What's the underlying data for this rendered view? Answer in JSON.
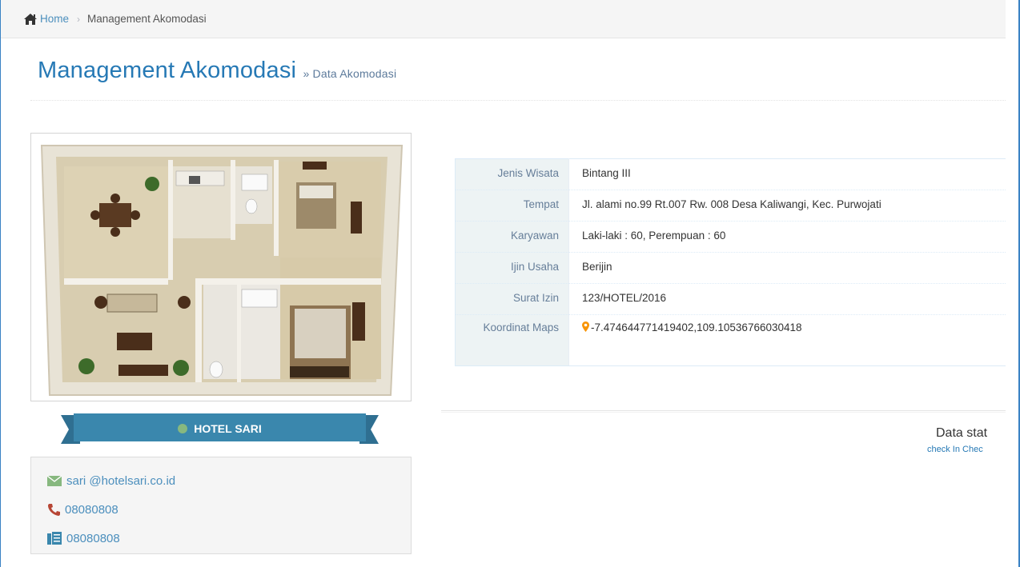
{
  "breadcrumb": {
    "home_label": "Home",
    "current": "Management Akomodasi"
  },
  "header": {
    "title": "Management Akomodasi",
    "subtitle": "» Data Akomodasi"
  },
  "hotel": {
    "name": "HOTEL SARI",
    "email": "sari @hotelsari.co.id",
    "phone": "08080808",
    "fax": "08080808"
  },
  "details": [
    {
      "label": "Jenis Wisata",
      "value": "Bintang III"
    },
    {
      "label": "Tempat",
      "value": "Jl. alami no.99 Rt.007 Rw. 008 Desa Kaliwangi, Kec. Purwojati"
    },
    {
      "label": "Karyawan",
      "value": "Laki-laki : 60, Perempuan : 60"
    },
    {
      "label": "Ijin Usaha",
      "value": "Berijin"
    },
    {
      "label": "Surat Izin",
      "value": "123/HOTEL/2016"
    },
    {
      "label": "Koordinat Maps",
      "value": "-7.474644771419402,109.10536766030418"
    }
  ],
  "stats": {
    "title": "Data stat",
    "subtitle": "check In Chec"
  },
  "colors": {
    "accent": "#2679b5",
    "link": "#4c8fbd",
    "ribbon": "#3a87ad",
    "status_dot": "#87b87f",
    "mail_icon": "#87b87f",
    "phone_icon": "#b74635",
    "map_marker": "#f89406"
  }
}
